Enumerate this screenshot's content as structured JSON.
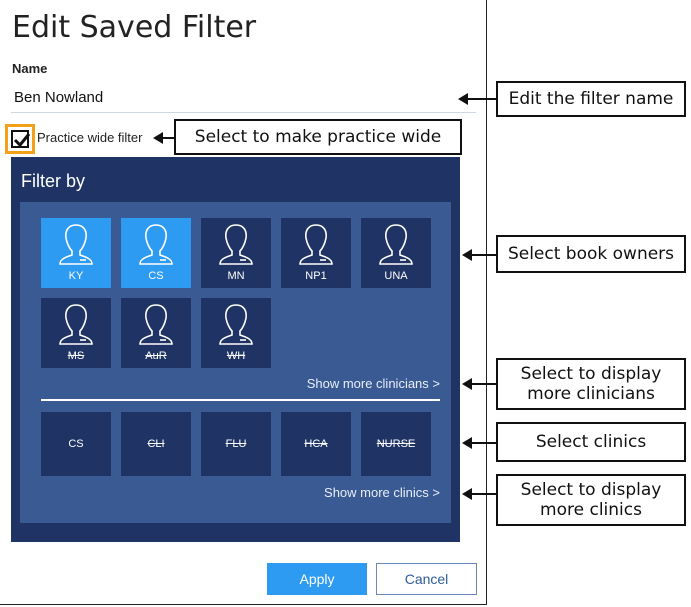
{
  "dialog": {
    "title": "Edit Saved Filter",
    "name_label": "Name",
    "name_value": "Ben Nowland",
    "practice_wide_label": "Practice wide filter",
    "practice_wide_checked": true
  },
  "filter": {
    "title": "Filter by",
    "book_owners": [
      {
        "label": "KY",
        "selected": true,
        "strikethrough": false
      },
      {
        "label": "CS",
        "selected": true,
        "strikethrough": false
      },
      {
        "label": "MN",
        "selected": false,
        "strikethrough": false
      },
      {
        "label": "NP1",
        "selected": false,
        "strikethrough": false
      },
      {
        "label": "UNA",
        "selected": false,
        "strikethrough": false
      },
      {
        "label": "MS",
        "selected": false,
        "strikethrough": true
      },
      {
        "label": "AuR",
        "selected": false,
        "strikethrough": true
      },
      {
        "label": "WH",
        "selected": false,
        "strikethrough": true
      }
    ],
    "show_more_clinicians": "Show more clinicians >",
    "clinics": [
      {
        "label": "CS",
        "strikethrough": false
      },
      {
        "label": "CLI",
        "strikethrough": true
      },
      {
        "label": "FLU",
        "strikethrough": true
      },
      {
        "label": "HCA",
        "strikethrough": true
      },
      {
        "label": "NURSE",
        "strikethrough": true
      }
    ],
    "show_more_clinics": "Show more clinics >"
  },
  "buttons": {
    "apply": "Apply",
    "cancel": "Cancel"
  },
  "callouts": {
    "edit_name": "Edit the filter name",
    "practice_wide": "Select to make practice wide",
    "book_owners": "Select book owners",
    "more_clinicians_line1": "Select to display",
    "more_clinicians_line2": "more clinicians",
    "clinics": "Select clinics",
    "more_clinics_line1": "Select to display",
    "more_clinics_line2": "more clinics"
  },
  "colors": {
    "panel_dark": "#1f3464",
    "panel_inner": "#3a5a94",
    "selected_tile": "#2e9bf3",
    "highlight": "#f4a11a",
    "apply_button": "#2e9bf3"
  }
}
